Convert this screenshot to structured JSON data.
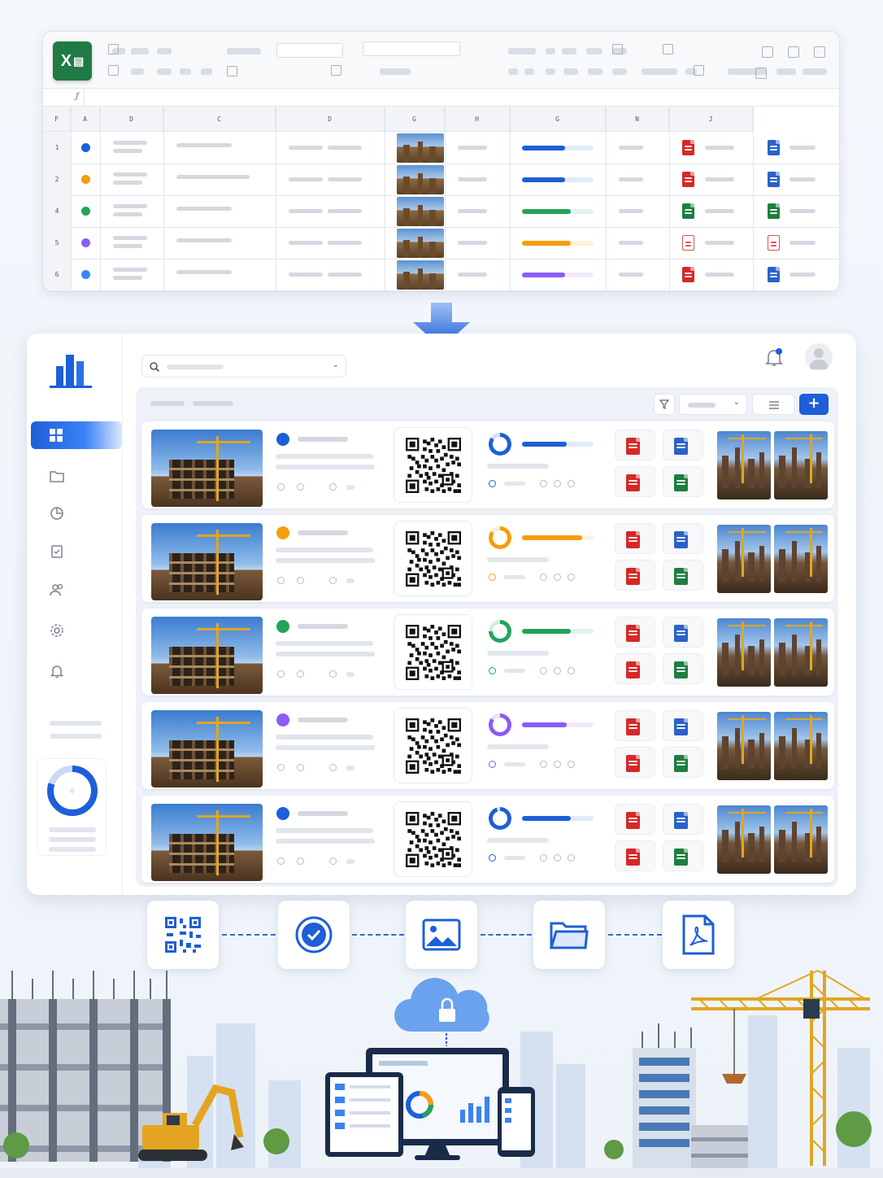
{
  "spreadsheet": {
    "app_icon": "excel-icon",
    "app_icon_label": "X",
    "column_headers": [
      "F",
      "A",
      "D",
      "C",
      "D",
      "G",
      "H",
      "G",
      "N",
      "J"
    ],
    "formula_bar_label": "ƒ",
    "rows": [
      {
        "row_number": "1",
        "status_color": "#1d5fd8",
        "progress_color": "#1d5fd8",
        "progress": 0.6,
        "file1": "pdf-icon",
        "file2": "doc-icon"
      },
      {
        "row_number": "2",
        "status_color": "#f59e0b",
        "progress_color": "#1d5fd8",
        "progress": 0.6,
        "file1": "pdf-icon",
        "file2": "doc-icon"
      },
      {
        "row_number": "4",
        "status_color": "#22a35a",
        "progress_color": "#22a35a",
        "progress": 0.68,
        "file1": "xls-icon",
        "file2": "xls-icon"
      },
      {
        "row_number": "5",
        "status_color": "#8b5cf6",
        "progress_color": "#f59e0b",
        "progress": 0.68,
        "file1": "pdf-outline-icon",
        "file2": "pdf-outline-icon"
      },
      {
        "row_number": "6",
        "status_color": "#3b82f6",
        "progress_color": "#8b5cf6",
        "progress": 0.6,
        "file1": "pdf-icon",
        "file2": "doc-icon"
      }
    ]
  },
  "transition_arrow": "arrow-down-icon",
  "app": {
    "logo": "buildings-logo-icon",
    "search_icon": "search-icon",
    "notifications_icon": "bell-icon",
    "avatar": "user-avatar-icon",
    "nav": [
      "dashboard-icon",
      "folder-icon",
      "pie-chart-icon",
      "clipboard-icon",
      "users-icon",
      "gear-icon",
      "bell-icon"
    ],
    "sidebar_ring_progress": 0.8,
    "toolbar": {
      "filter_icon": "filter-icon",
      "list_icon": "list-icon",
      "add_label": "+"
    },
    "projects": [
      {
        "status_color": "#1d5fd8",
        "progress_color": "#1d5fd8",
        "progress": 0.6,
        "ring_progress": 0.85
      },
      {
        "status_color": "#f59e0b",
        "progress_color": "#f59e0b",
        "progress": 0.8,
        "ring_progress": 0.85
      },
      {
        "status_color": "#22a35a",
        "progress_color": "#22a35a",
        "progress": 0.65,
        "ring_progress": 0.75
      },
      {
        "status_color": "#8b5cf6",
        "progress_color": "#8b5cf6",
        "progress": 0.6,
        "ring_progress": 0.85
      },
      {
        "status_color": "#1d5fd8",
        "progress_color": "#1d5fd8",
        "progress": 0.65,
        "ring_progress": 0.95
      }
    ]
  },
  "workflow": [
    "qr-code-icon",
    "check-circle-icon",
    "image-icon",
    "folder-icon",
    "pdf-icon"
  ],
  "scene": {
    "cloud_icon": "cloud-lock-icon",
    "devices": "devices-illustration"
  },
  "colors": {
    "accent": "#1d5fd8",
    "excel_green": "#1f7a43",
    "pdf_red": "#d62828",
    "doc_blue": "#2a62c9"
  }
}
